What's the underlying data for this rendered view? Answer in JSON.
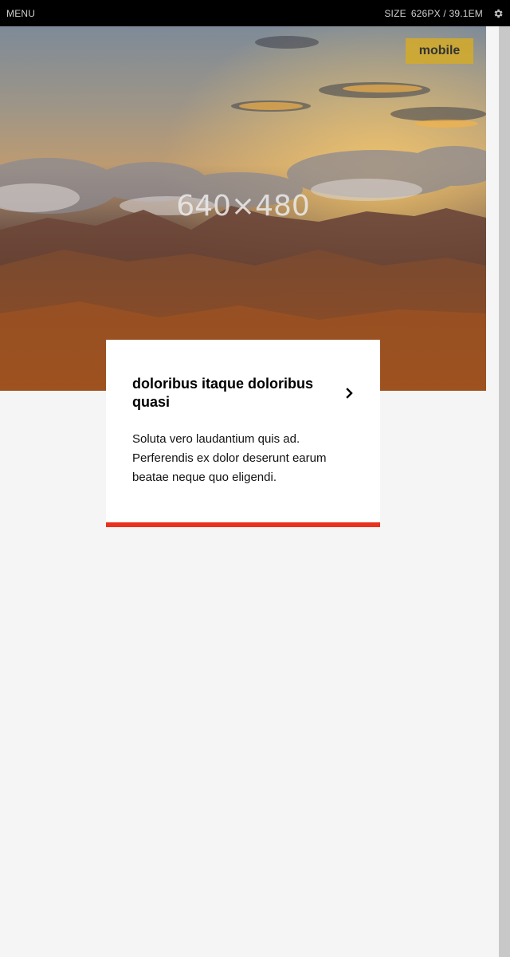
{
  "topbar": {
    "menu_label": "MENU",
    "size_label": "SIZE",
    "size_value": "626PX / 39.1EM",
    "settings_icon": "gear-icon"
  },
  "hero": {
    "dimension_label": "640×480",
    "badge_label": "mobile"
  },
  "card": {
    "title": "doloribus itaque doloribus quasi",
    "body": "Soluta vero laudantium quis ad. Perferendis ex dolor deserunt earum beatae neque quo eligendi.",
    "arrow_icon": "chevron-right-icon",
    "accent_color": "#e8321e"
  }
}
